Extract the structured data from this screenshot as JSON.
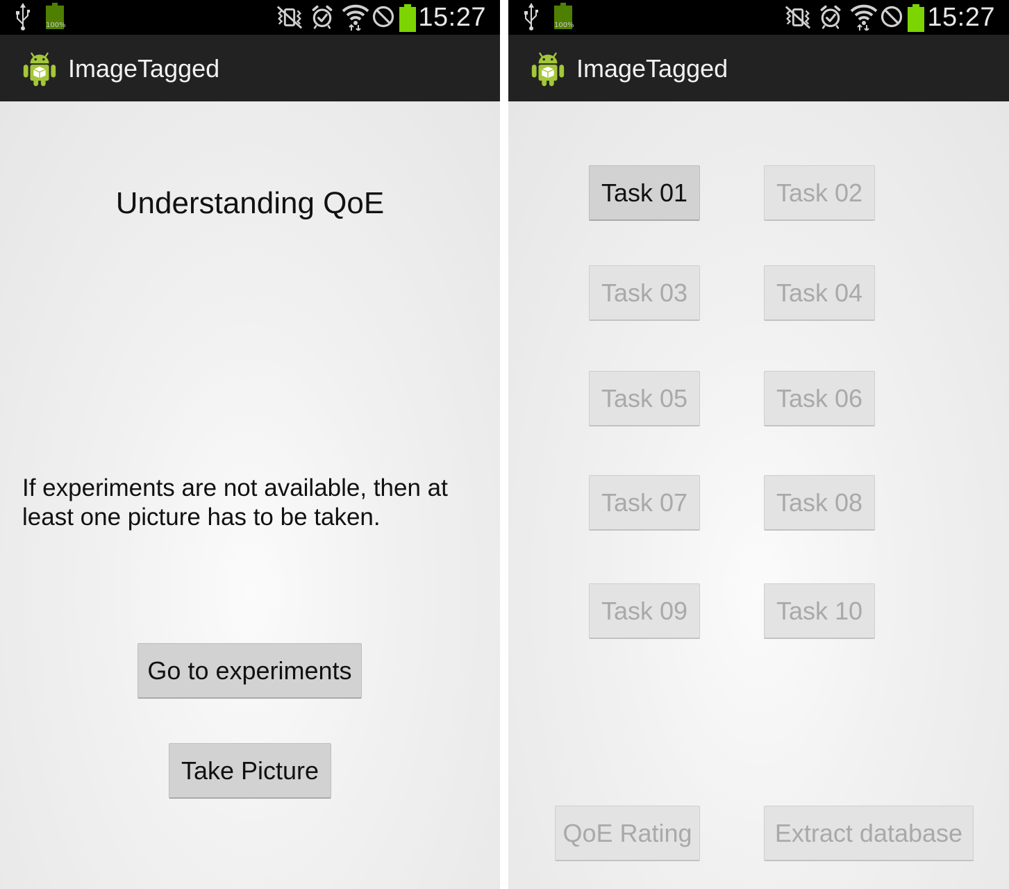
{
  "left_screen": {
    "status_bar": {
      "time": "15:27",
      "battery_small_label": "100%",
      "icons": [
        "usb-icon",
        "battery-charging-icon",
        "vibrate-mode-icon",
        "alarm-icon",
        "wifi-icon",
        "blocking-mode-icon",
        "battery-full-icon"
      ]
    },
    "action_bar": {
      "app_title": "ImageTagged",
      "app_icon": "android-app-icon"
    },
    "heading": "Understanding QoE",
    "message": "If experiments are not available, then at least one picture has to be taken.",
    "buttons": {
      "go_to_experiments": "Go to experiments",
      "take_picture": "Take Picture"
    }
  },
  "right_screen": {
    "status_bar": {
      "time": "15:27",
      "battery_small_label": "100%",
      "icons": [
        "usb-icon",
        "battery-charging-icon",
        "vibrate-mode-icon",
        "alarm-icon",
        "wifi-icon",
        "blocking-mode-icon",
        "battery-full-icon"
      ]
    },
    "action_bar": {
      "app_title": "ImageTagged",
      "app_icon": "android-app-icon"
    },
    "tasks": [
      {
        "label": "Task 01",
        "enabled": true
      },
      {
        "label": "Task 02",
        "enabled": false
      },
      {
        "label": "Task 03",
        "enabled": false
      },
      {
        "label": "Task 04",
        "enabled": false
      },
      {
        "label": "Task 05",
        "enabled": false
      },
      {
        "label": "Task 06",
        "enabled": false
      },
      {
        "label": "Task 07",
        "enabled": false
      },
      {
        "label": "Task 08",
        "enabled": false
      },
      {
        "label": "Task 09",
        "enabled": false
      },
      {
        "label": "Task 10",
        "enabled": false
      }
    ],
    "bottom_buttons": {
      "qoe_rating": {
        "label": "QoE Rating",
        "enabled": false
      },
      "extract_database": {
        "label": "Extract database",
        "enabled": false
      }
    }
  },
  "colors": {
    "status_bar_bg": "#000000",
    "action_bar_bg": "#222222",
    "button_enabled_bg": "#d2d2d2",
    "button_disabled_text": "#a9a9a9",
    "android_green": "#a4c639",
    "battery_green": "#7cd400"
  }
}
